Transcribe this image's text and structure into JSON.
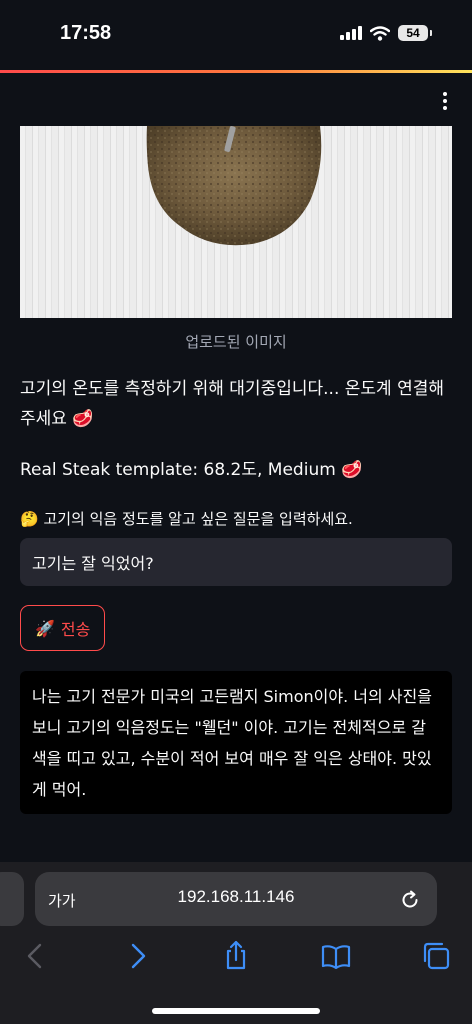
{
  "status_bar": {
    "time": "17:58",
    "battery": "54"
  },
  "image": {
    "caption": "업로드된 이미지"
  },
  "status_message": "고기의 온도를 측정하기 위해 대기중입니다... 온도계 연결해주세요 🥩",
  "template_result": "Real Steak template: 68.2도, Medium 🥩",
  "prompt_label": "🤔 고기의 익음 정도를 알고 싶은 질문을 입력하세요.",
  "question_input": {
    "value": "고기는 잘 익었어?"
  },
  "send_button": {
    "icon": "🚀",
    "label": "전송"
  },
  "answer": "나는 고기 전문가 미국의 고든램지 Simon이야. 너의 사진을 보니 고기의 익음정도는 \"웰던\" 이야. 고기는 전체적으로 갈색을 띠고 있고, 수분이 적어 보여 매우 잘 익은 상태야. 맛있게 먹어.",
  "browser": {
    "aa_label": "가가",
    "url": "192.168.11.146",
    "toolbar_icons": [
      "back-arrow-icon",
      "forward-arrow-icon",
      "share-icon",
      "bookmarks-icon",
      "tabs-icon"
    ]
  },
  "colors": {
    "background": "#0e1117",
    "accent": "#ff4b4b",
    "input_bg": "#262730",
    "answer_bg": "#000000"
  }
}
